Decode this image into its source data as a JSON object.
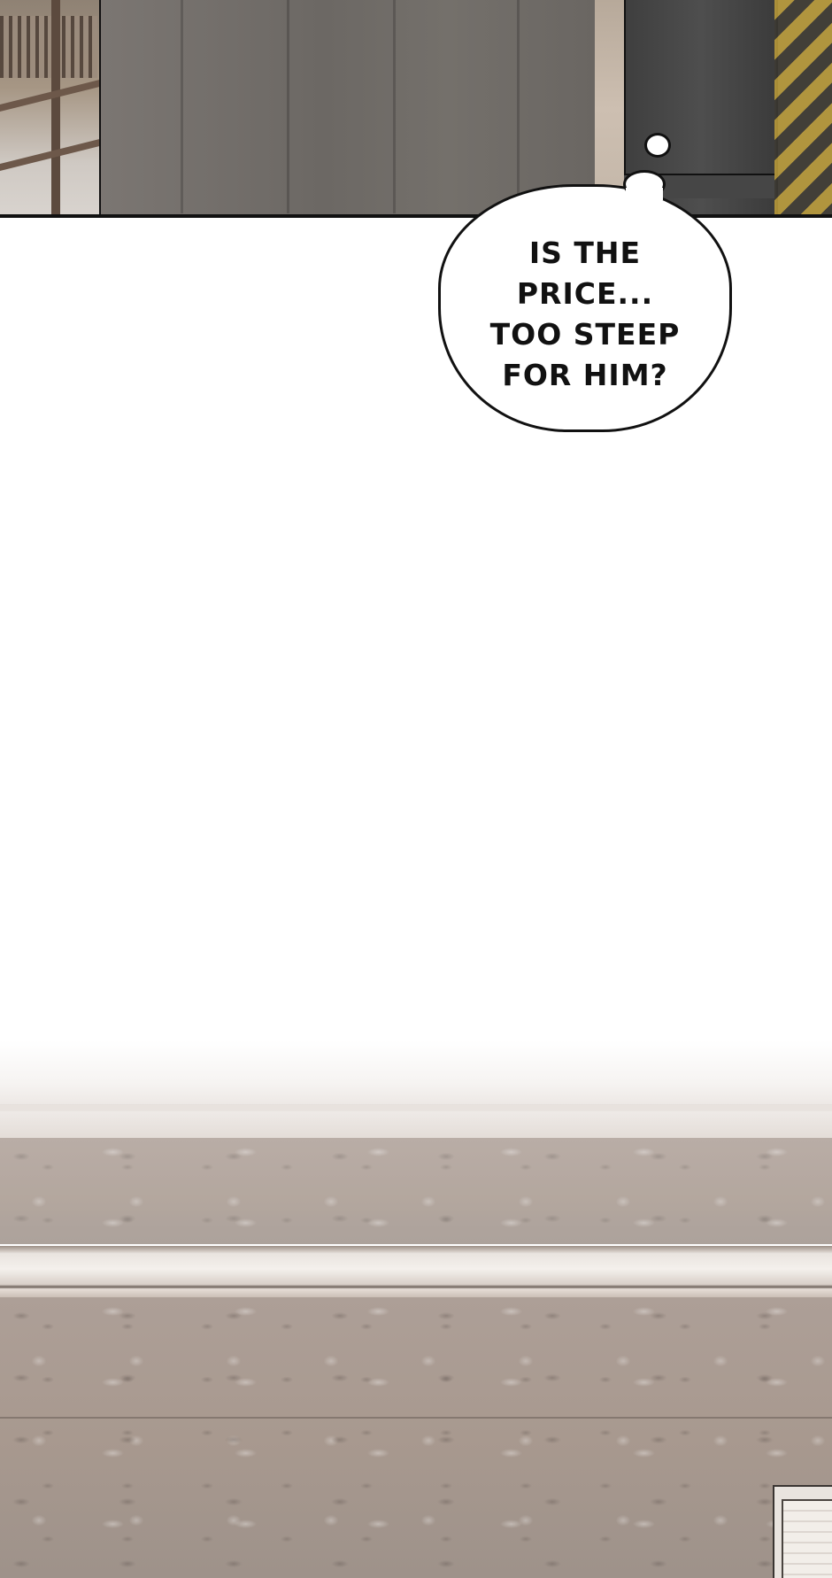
{
  "speech_bubble": {
    "lines": [
      "IS THE",
      "PRICE...",
      "TOO STEEP",
      "FOR HIM?"
    ]
  },
  "colors": {
    "bubble_fill": "#ffffff",
    "bubble_outline": "#111111",
    "left_pants": "#74706b",
    "right_pants": "#474747",
    "wall_stone": "#a8998f"
  }
}
